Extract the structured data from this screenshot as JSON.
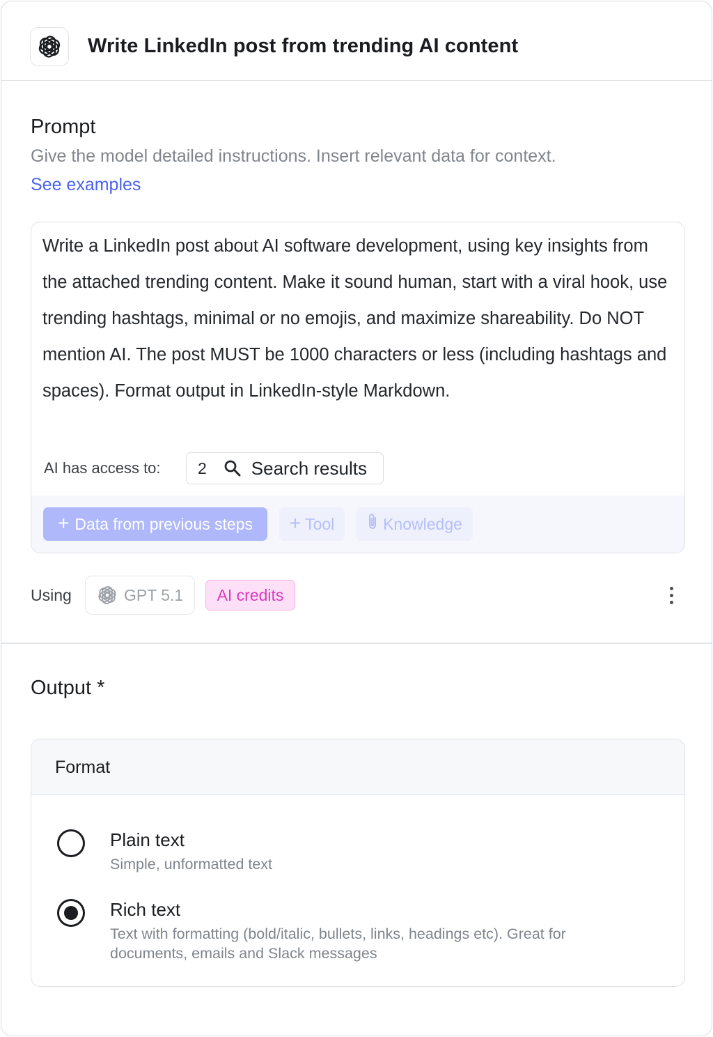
{
  "header": {
    "title": "Write LinkedIn post from trending AI content",
    "icon": "openai-logo-icon"
  },
  "prompt": {
    "title": "Prompt",
    "description": "Give the model detailed instructions. Insert relevant data for context.",
    "link": "See examples",
    "text": "Write a LinkedIn post about AI software development, using key insights from the attached trending content. Make it sound human, start with a viral hook, use trending hashtags, minimal or no emojis, and maximize shareability. Do NOT mention AI. The post MUST be 1000 characters or less (including hashtags and spaces). Format output in LinkedIn-style Markdown.",
    "access_label": "AI has access to:",
    "access_count": "2",
    "access_item": "Search results",
    "access_icon": "search-icon"
  },
  "toolbar": {
    "data_button": "Data from previous steps",
    "tool_button": "Tool",
    "knowledge_button": "Knowledge"
  },
  "model": {
    "using_label": "Using",
    "name": "GPT 5.1",
    "credits_badge": "AI credits"
  },
  "output": {
    "title": "Output *",
    "format_label": "Format",
    "options": [
      {
        "title": "Plain text",
        "description": "Simple, unformatted text",
        "selected": false
      },
      {
        "title": "Rich text",
        "description": "Text with formatting (bold/italic, bullets, links, headings etc). Great for documents, emails and Slack messages",
        "selected": true
      }
    ]
  },
  "colors": {
    "accent": "#4a63f0",
    "primary_button": "#aeb8fb",
    "credits_badge_bg": "#fde0f7",
    "credits_badge_text": "#d63dbc"
  }
}
